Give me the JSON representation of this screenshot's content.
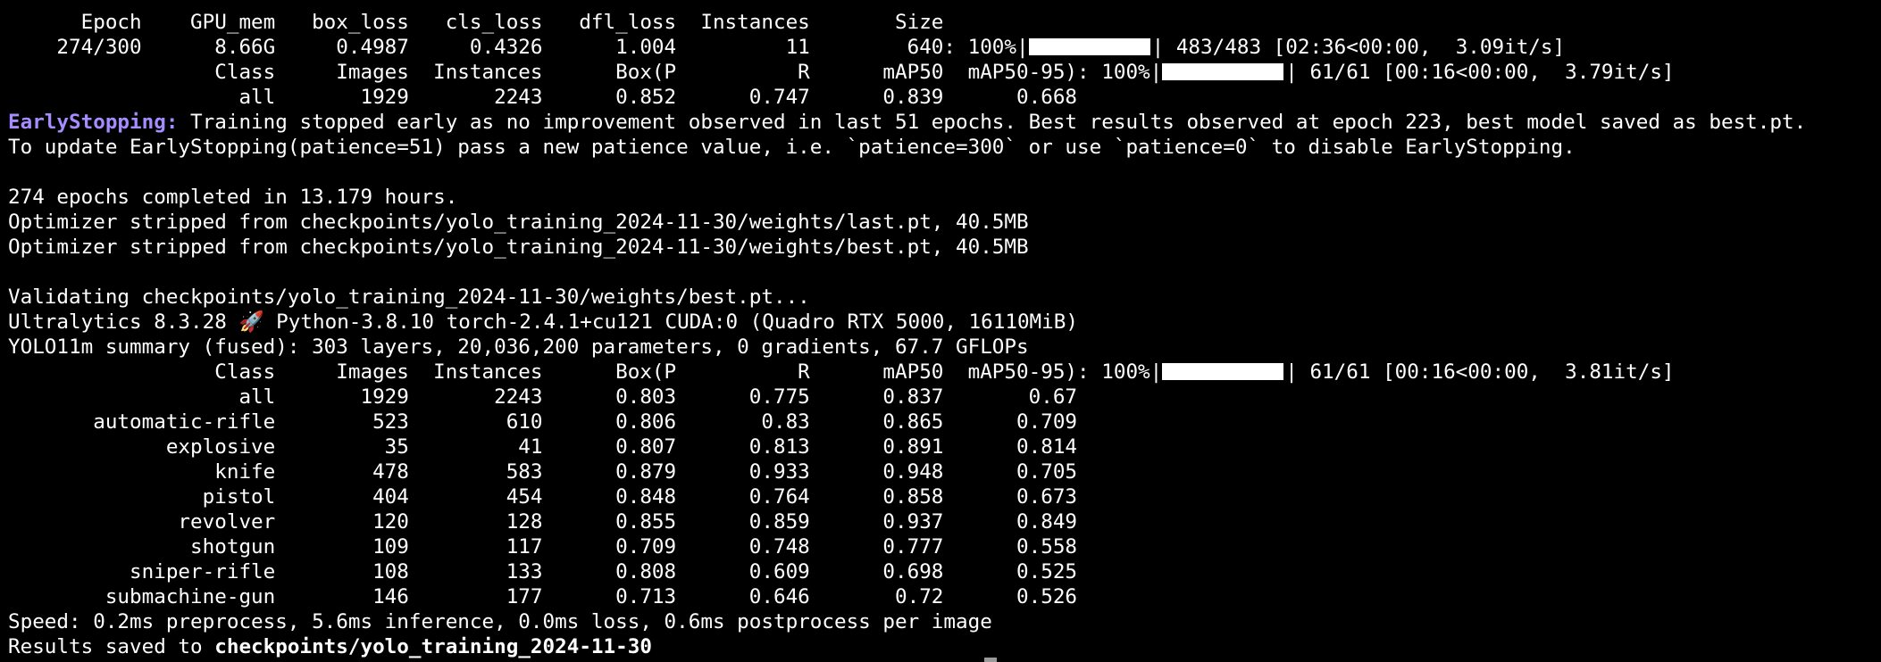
{
  "epoch_block": {
    "header": "      Epoch    GPU_mem   box_loss   cls_loss   dfl_loss  Instances       Size",
    "row_prefix": "    274/300      8.66G     0.4987     0.4326      1.004         11        640: 100%|",
    "row_suffix": "| 483/483 [02:36<00:00,  3.09it/s]",
    "val_header_prefix": "                 Class     Images  Instances      Box(P          R      mAP50  mAP50-95): 100%|",
    "val_header_suffix": "| 61/61 [00:16<00:00,  3.79it/s]",
    "val_all_row": "                   all       1929       2243      0.852      0.747      0.839      0.668"
  },
  "early_stopping": {
    "label": "EarlyStopping:",
    "message": " Training stopped early as no improvement observed in last 51 epochs. Best results observed at epoch 223, best model saved as best.pt.",
    "hint": "To update EarlyStopping(patience=51) pass a new patience value, i.e. `patience=300` or use `patience=0` to disable EarlyStopping."
  },
  "summary": {
    "completed": "274 epochs completed in 13.179 hours.",
    "strip_last": "Optimizer stripped from checkpoints/yolo_training_2024-11-30/weights/last.pt, 40.5MB",
    "strip_best": "Optimizer stripped from checkpoints/yolo_training_2024-11-30/weights/best.pt, 40.5MB"
  },
  "validation": {
    "validating": "Validating checkpoints/yolo_training_2024-11-30/weights/best.pt...",
    "env": "Ultralytics 8.3.28 🚀 Python-3.8.10 torch-2.4.1+cu121 CUDA:0 (Quadro RTX 5000, 16110MiB)",
    "model_summary": "YOLO11m summary (fused): 303 layers, 20,036,200 parameters, 0 gradients, 67.7 GFLOPs",
    "header_prefix": "                 Class     Images  Instances      Box(P          R      mAP50  mAP50-95): 100%|",
    "header_suffix": "| 61/61 [00:16<00:00,  3.81it/s]",
    "rows": [
      "                   all       1929       2243      0.803      0.775      0.837       0.67",
      "       automatic-rifle        523        610      0.806       0.83      0.865      0.709",
      "             explosive         35         41      0.807      0.813      0.891      0.814",
      "                 knife        478        583      0.879      0.933      0.948      0.705",
      "                pistol        404        454      0.848      0.764      0.858      0.673",
      "              revolver        120        128      0.855      0.859      0.937      0.849",
      "               shotgun        109        117      0.709      0.748      0.777      0.558",
      "          sniper-rifle        108        133      0.808      0.609      0.698      0.525",
      "        submachine-gun        146        177      0.713      0.646       0.72      0.526"
    ]
  },
  "footer": {
    "speed": "Speed: 0.2ms preprocess, 5.6ms inference, 0.0ms loss, 0.6ms postprocess per image",
    "results_prefix": "Results saved to ",
    "results_path": "checkpoints/yolo_training_2024-11-30"
  },
  "colors": {
    "background": "#000000",
    "text": "#ffffff",
    "early_stopping_label": "#a58cff"
  }
}
